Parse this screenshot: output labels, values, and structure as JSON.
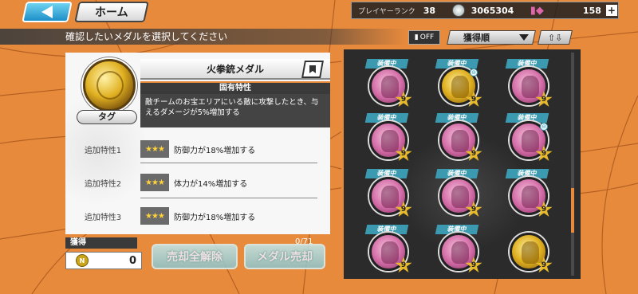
{
  "header": {
    "home_label": "ホーム",
    "player_rank_label": "プレイヤーランク",
    "player_rank": "38",
    "coins": "3065304",
    "gems": "158",
    "plus": "+"
  },
  "instruction": "確認したいメダルを選択してください",
  "toolbar": {
    "filter_label": "OFF",
    "sort_label": "獲得順"
  },
  "detail": {
    "medal_name": "火拳銃メダル",
    "tag_label": "タグ",
    "unique_trait_header": "固有特性",
    "unique_trait_desc": "敵チームのお宝エリアにいる敵に攻撃したとき、与えるダメージが5%増加する",
    "traits": [
      {
        "label": "追加特性1",
        "stars": "★★★",
        "text": "防御力が18%増加する"
      },
      {
        "label": "追加特性2",
        "stars": "★★★",
        "text": "体力が14%増加する"
      },
      {
        "label": "追加特性3",
        "stars": "★★★",
        "text": "防御力が18%増加する"
      }
    ]
  },
  "owned": {
    "label": "獲得",
    "coin_icon": "N",
    "value": "0"
  },
  "actions": {
    "unsell_all_label": "売却全解除",
    "sell_label": "メダル売却",
    "sell_count": "0/71"
  },
  "grid": {
    "equipped_label": "装備中",
    "level_label": "9",
    "lock_glyph": "⊖",
    "cells": [
      {
        "color": "pink",
        "equipped": true,
        "locked": false
      },
      {
        "color": "gold",
        "equipped": true,
        "locked": true
      },
      {
        "color": "pink",
        "equipped": true,
        "locked": false
      },
      {
        "color": "pink",
        "equipped": true,
        "locked": false
      },
      {
        "color": "pink",
        "equipped": true,
        "locked": false
      },
      {
        "color": "pink",
        "equipped": true,
        "locked": true
      },
      {
        "color": "pink",
        "equipped": true,
        "locked": false
      },
      {
        "color": "pink",
        "equipped": true,
        "locked": false
      },
      {
        "color": "pink",
        "equipped": true,
        "locked": false
      },
      {
        "color": "pink",
        "equipped": true,
        "locked": false
      },
      {
        "color": "pink",
        "equipped": true,
        "locked": false
      },
      {
        "color": "gold",
        "equipped": false,
        "locked": false
      }
    ]
  },
  "colors": {
    "accent": "#e88a3c",
    "banner": "#3c9ab0",
    "star": "#e7b92b"
  }
}
